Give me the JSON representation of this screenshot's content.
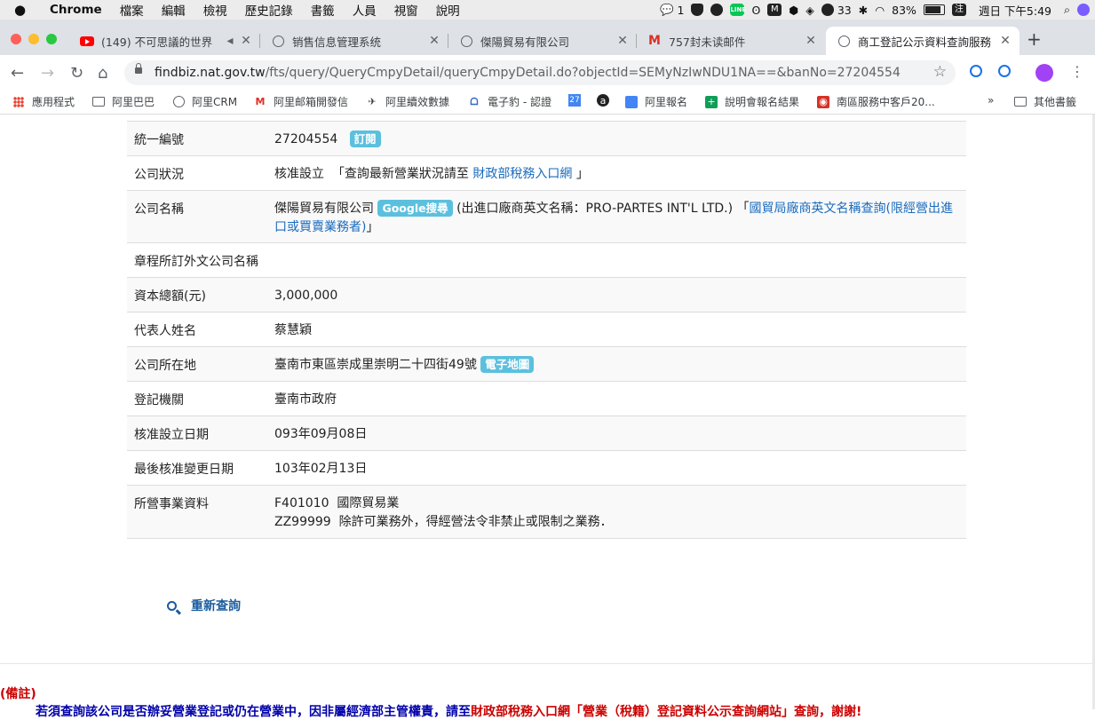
{
  "menubar": {
    "app": "Chrome",
    "items": [
      "檔案",
      "編輯",
      "檢視",
      "歷史記錄",
      "書籤",
      "人員",
      "視窗",
      "說明"
    ],
    "wechat_count": "1",
    "dropbox_count": "33",
    "battery": "83%",
    "input_method": "注",
    "datetime": "週日 下午5:49"
  },
  "tabs": [
    {
      "title": "(149) 不可思議的世界"
    },
    {
      "title": "销售信息管理系统"
    },
    {
      "title": "傑陽貿易有限公司"
    },
    {
      "title": "757封未读邮件"
    },
    {
      "title": "商工登記公示資料查詢服務"
    }
  ],
  "toolbar": {
    "url_host": "findbiz.nat.gov.tw",
    "url_rest": "/fts/query/QueryCmpyDetail/queryCmpyDetail.do?objectId=SEMyNzIwNDU1NA==&banNo=27204554"
  },
  "bookmarks": {
    "items": [
      "應用程式",
      "阿里巴巴",
      "阿里CRM",
      "阿里邮箱開發信",
      "阿里續效數據",
      "電子豹 - 認證",
      "27",
      "a",
      "阿里報名",
      "說明會報名結果",
      "南區服務中客戶20..."
    ],
    "more": "»",
    "other": "其他書籤"
  },
  "company": {
    "ban_label": "統一編號",
    "ban_value": "27204554",
    "subscribe": "訂閱",
    "status_label": "公司狀況",
    "status_value": "核准設立",
    "status_pre": "「查詢最新營業狀況請至",
    "status_link": "財政部稅務入口網",
    "status_post": "」",
    "name_label": "公司名稱",
    "name_value": "傑陽貿易有限公司",
    "google": "Google搜尋",
    "name_en": "(出進口廠商英文名稱：PRO-PARTES INT'L LTD.)",
    "name_quote_open": "「",
    "name_link": "國貿局廠商英文名稱查詢(限經營出進口或買賣業務者)",
    "name_quote_close": "」",
    "foreign_label": "章程所訂外文公司名稱",
    "foreign_value": "",
    "capital_label": "資本總額(元)",
    "capital_value": "3,000,000",
    "rep_label": "代表人姓名",
    "rep_value": "蔡慧穎",
    "addr_label": "公司所在地",
    "addr_value": "臺南市東區崇成里崇明二十四街49號",
    "map": "電子地圖",
    "authority_label": "登記機關",
    "authority_value": "臺南市政府",
    "setup_label": "核准設立日期",
    "setup_value": "093年09月08日",
    "change_label": "最後核准變更日期",
    "change_value": "103年02月13日",
    "biz_label": "所營事業資料",
    "biz_items": [
      {
        "code": "F401010",
        "desc": "國際貿易業"
      },
      {
        "code": "ZZ99999",
        "desc": "除許可業務外，得經營法令非禁止或限制之業務．"
      }
    ]
  },
  "requery": "重新查詢",
  "note": {
    "title": "(備註)",
    "line_a": "若須查詢該公司是否辦妥營業登記或仍在營業中，因非屬經濟部主管權責，請至",
    "line_link": "財政部稅務入口網",
    "line_b": "「營業（稅籍）登記資料公示查詢網站」查詢，謝謝!"
  }
}
